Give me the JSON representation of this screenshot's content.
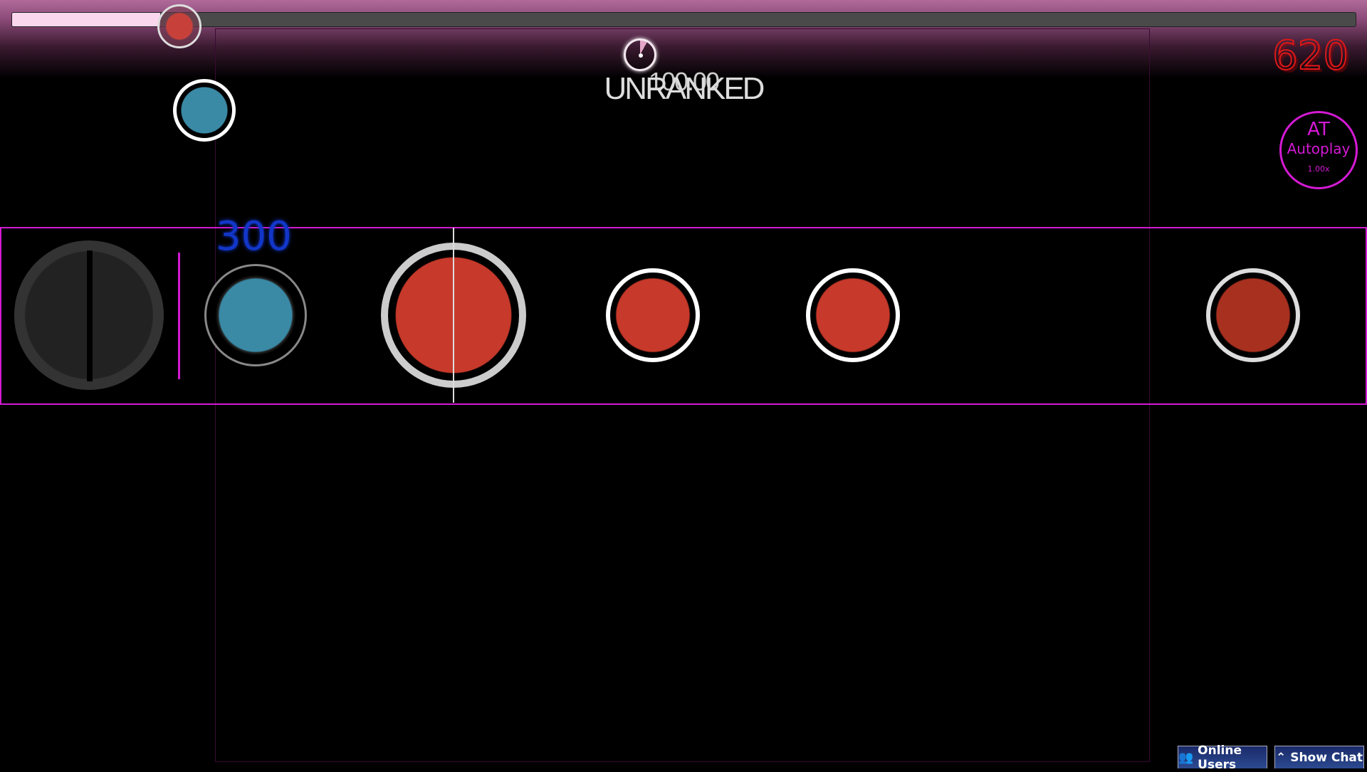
{
  "progress": {
    "fraction": 0.11
  },
  "hud": {
    "rank": "UNRANKED",
    "accuracy": "100.00",
    "combo": "620",
    "judgement": "300"
  },
  "mod": {
    "short": "AT",
    "name": "Autoplay",
    "speed": "1.00x"
  },
  "buttons": {
    "online_users": "Online Users",
    "show_chat": "Show Chat"
  },
  "colors": {
    "don": "#c7392a",
    "ka": "#3a8aa6",
    "lane": "#d41ad4",
    "combo": "#e01818"
  },
  "icons": [
    "users-icon",
    "chevron-up-icon"
  ]
}
